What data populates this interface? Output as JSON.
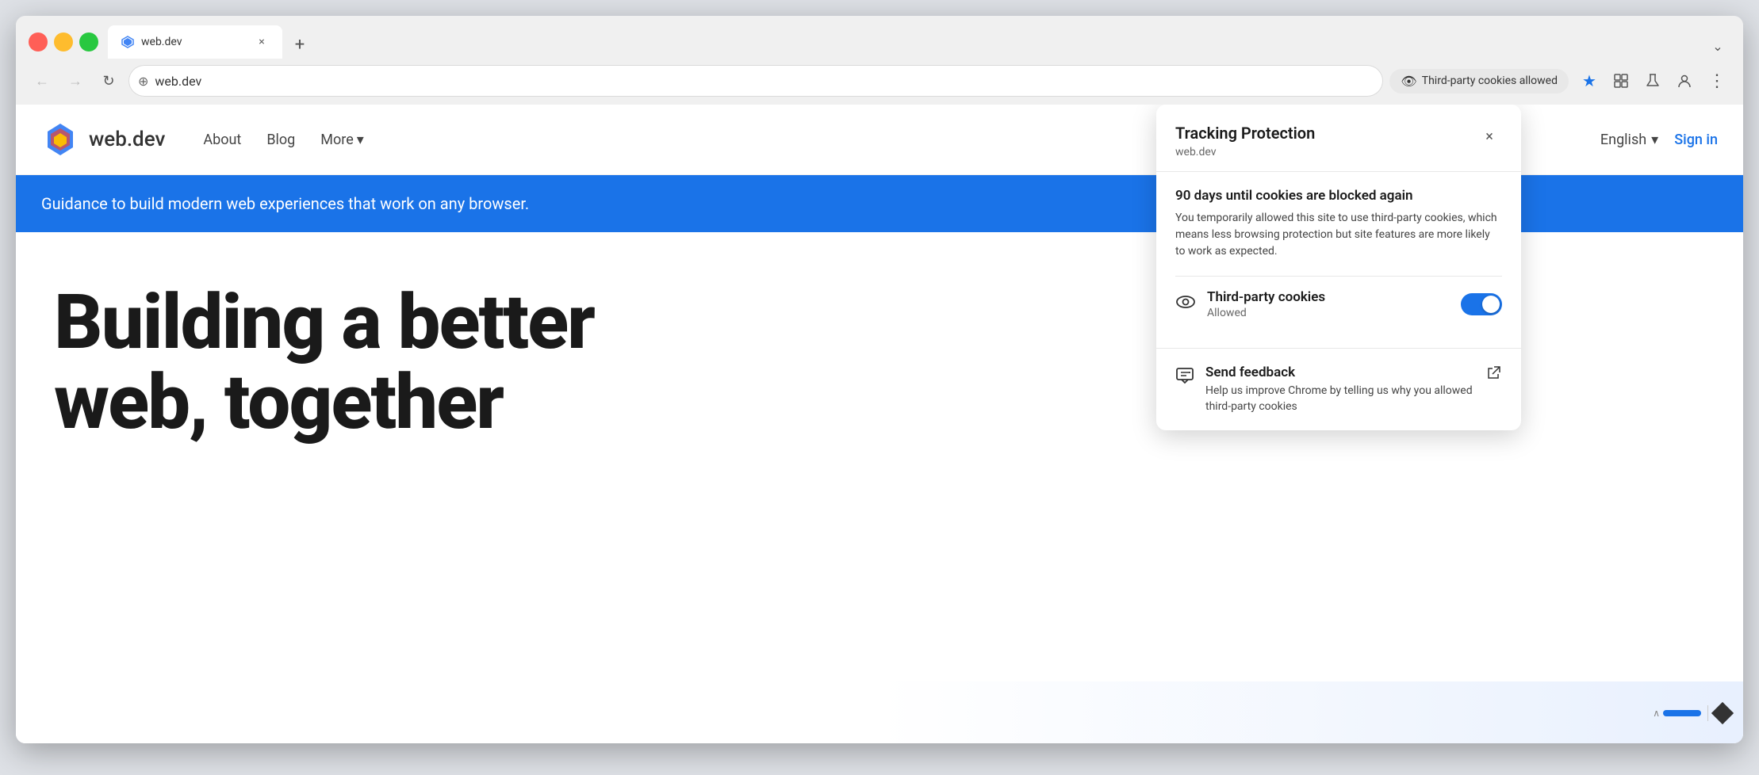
{
  "browser": {
    "tab": {
      "favicon": "▶",
      "title": "web.dev",
      "close_label": "×"
    },
    "new_tab_label": "+",
    "tab_list_label": "⌄",
    "address": "web.dev",
    "back_label": "←",
    "forward_label": "→",
    "reload_label": "↻",
    "address_security_icon": "⊕",
    "tracking_badge_label": "Third-party cookies allowed",
    "tracking_badge_icon": "👁",
    "star_label": "★",
    "extensions_label": "⬜",
    "lab_icon": "⚗",
    "profile_icon": "⊙",
    "menu_icon": "⋮"
  },
  "site": {
    "logo_text": "web.dev",
    "nav": {
      "about_label": "About",
      "blog_label": "Blog",
      "more_label": "More",
      "more_arrow": "▾"
    },
    "right": {
      "language_label": "English",
      "language_arrow": "▾",
      "sign_in_label": "Sign in"
    },
    "hero_banner": "Guidance to build modern web experiences that work on any browser.",
    "heading_line1": "Building a better",
    "heading_line2": "web, together"
  },
  "popup": {
    "title": "Tracking Protection",
    "domain": "web.dev",
    "close_label": "×",
    "notice_title": "90 days until cookies are blocked again",
    "notice_desc": "You temporarily allowed this site to use third-party cookies, which means less browsing protection but site features are more likely to work as expected.",
    "cookie_label": "Third-party cookies",
    "cookie_status": "Allowed",
    "cookie_icon": "👁",
    "feedback_title": "Send feedback",
    "feedback_desc": "Help us improve Chrome by telling us why you allowed third-party cookies",
    "feedback_icon": "💬",
    "feedback_ext_icon": "⬀"
  }
}
